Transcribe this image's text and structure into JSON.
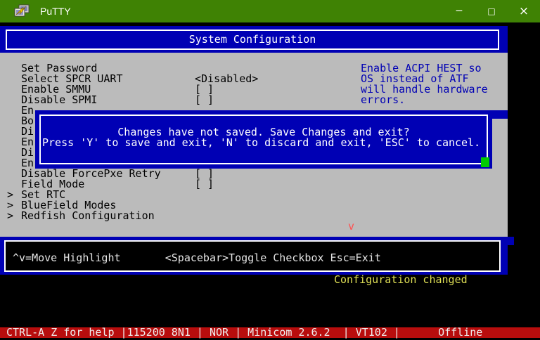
{
  "window": {
    "title": "PuTTY",
    "controls": {
      "minimize": "─",
      "maximize": "□",
      "close": "×"
    }
  },
  "colors": {
    "titlebar_green": "#3F8204",
    "efi_blue": "#0000B4",
    "terminal_gray": "#BBBBBB",
    "status_yellow": "#DFDF55",
    "minicom_red": "#B80D0D",
    "cursor_green": "#00CC00",
    "scroll_indicator_red": "#FF5050"
  },
  "efi": {
    "title": "System Configuration",
    "menu_rows": [
      {
        "prefix": "",
        "label": "Set Password",
        "value": ""
      },
      {
        "prefix": "",
        "label": "Select SPCR UART",
        "value": "<Disabled>"
      },
      {
        "prefix": "",
        "label": "Enable SMMU",
        "value": "[ ]"
      },
      {
        "prefix": "",
        "label": "Disable SPMI",
        "value": "[ ]"
      },
      {
        "prefix": "",
        "label": "En",
        "value": ""
      },
      {
        "prefix": "",
        "label": "Bo",
        "value": ""
      },
      {
        "prefix": "",
        "label": "Di",
        "value": ""
      },
      {
        "prefix": "",
        "label": "En",
        "value": ""
      },
      {
        "prefix": "",
        "label": "Di",
        "value": ""
      },
      {
        "prefix": "",
        "label": "En",
        "value": ""
      },
      {
        "prefix": "",
        "label": "Disable ForcePxe Retry",
        "value": "[ ]"
      },
      {
        "prefix": "",
        "label": "Field Mode",
        "value": "[ ]"
      },
      {
        "prefix": ">",
        "label": "Set RTC",
        "value": ""
      },
      {
        "prefix": ">",
        "label": "BlueField Modes",
        "value": ""
      },
      {
        "prefix": ">",
        "label": "Redfish Configuration",
        "value": ""
      }
    ],
    "help_lines": [
      "Enable ACPI HEST so",
      "OS instead of ATF",
      "will handle hardware",
      "errors."
    ],
    "dialog": {
      "line1": "Changes have not saved. Save Changes and exit?",
      "line2": "Press 'Y' to save and exit, 'N' to discard and exit, 'ESC' to cancel."
    },
    "scroll_down_indicator": "v",
    "footer_keys": "^v=Move Highlight       <Spacebar>Toggle Checkbox Esc=Exit",
    "status_message": "Configuration changed"
  },
  "minicom": {
    "status_line": "CTRL-A Z for help |115200 8N1 | NOR | Minicom 2.6.2  | VT102 |      Offline"
  }
}
